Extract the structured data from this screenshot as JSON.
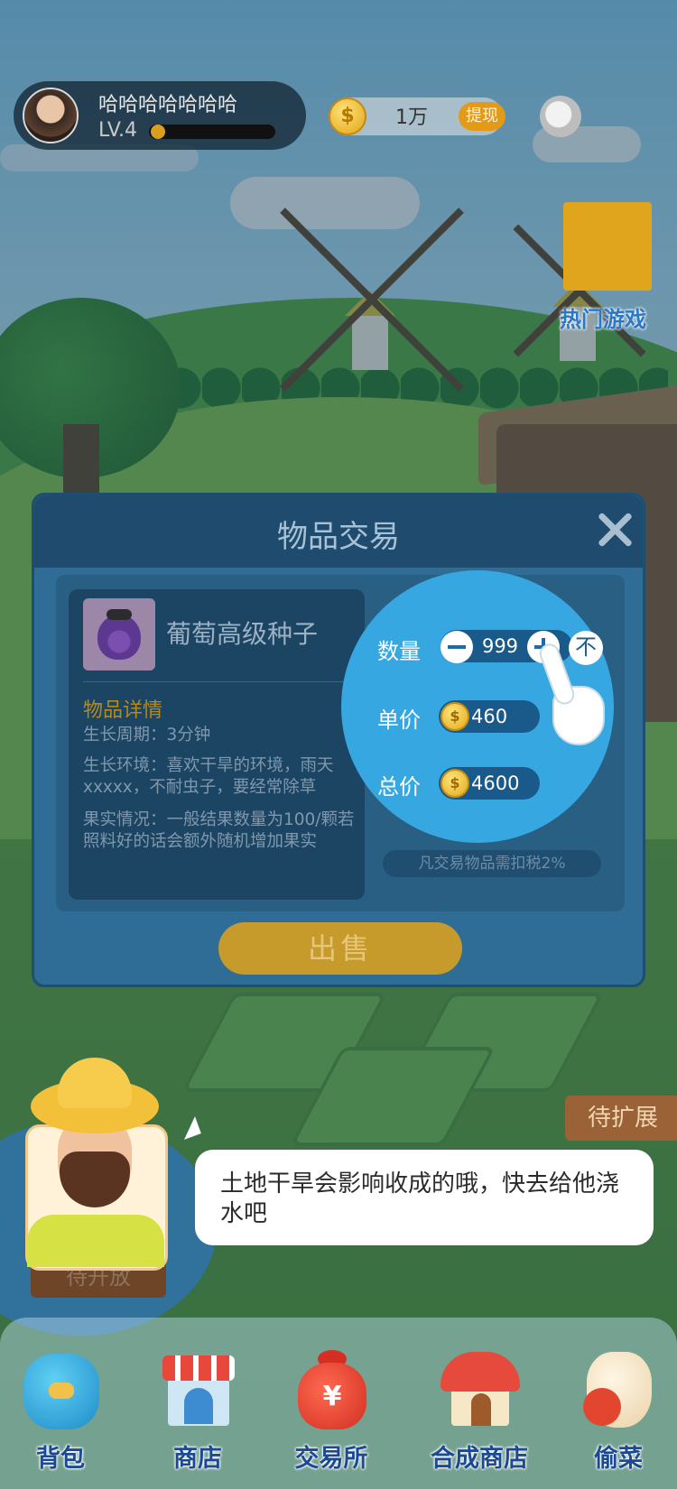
{
  "top_bar": {
    "username": "哈哈哈哈哈哈哈",
    "level": "LV.4",
    "coins": "1万",
    "withdraw_label": "提现",
    "hot_games_label": "热门游戏"
  },
  "dialog": {
    "title": "物品交易",
    "item": {
      "name": "葡萄高级种子",
      "details_title": "物品详情",
      "growth_cycle": "生长周期：3分钟",
      "growth_env": "生长环境：喜欢干旱的环境，雨天xxxxx，不耐虫子，要经常除草",
      "fruit_info": "果实情况：一般结果数量为100/颗若照料好的话会额外随机增加果实"
    },
    "quantity_label": "数量",
    "quantity_value": "999",
    "max_label": "不",
    "unit_price_label": "单价",
    "unit_price_value": "460",
    "total_price_label": "总价",
    "total_price_value": "4600",
    "tax_note": "凡交易物品需扣税2%",
    "sell_label": "出售"
  },
  "signs": {
    "expand": "待扩展",
    "open": "待开放"
  },
  "tip": {
    "text": "土地干旱会影响收成的哦，快去给他浇水吧"
  },
  "bottom_nav": [
    {
      "label": "背包",
      "icon": "backpack-icon"
    },
    {
      "label": "商店",
      "icon": "shop-icon"
    },
    {
      "label": "交易所",
      "icon": "money-bag-icon"
    },
    {
      "label": "合成商店",
      "icon": "house-icon"
    },
    {
      "label": "偷菜",
      "icon": "glove-icon"
    }
  ],
  "colors": {
    "dialog_bg": "#2f6d96",
    "dialog_header": "#1f4c6e",
    "control_circle": "#36a7e0",
    "sell_button": "#c79a2c",
    "nav_label": "#1c4a92"
  }
}
